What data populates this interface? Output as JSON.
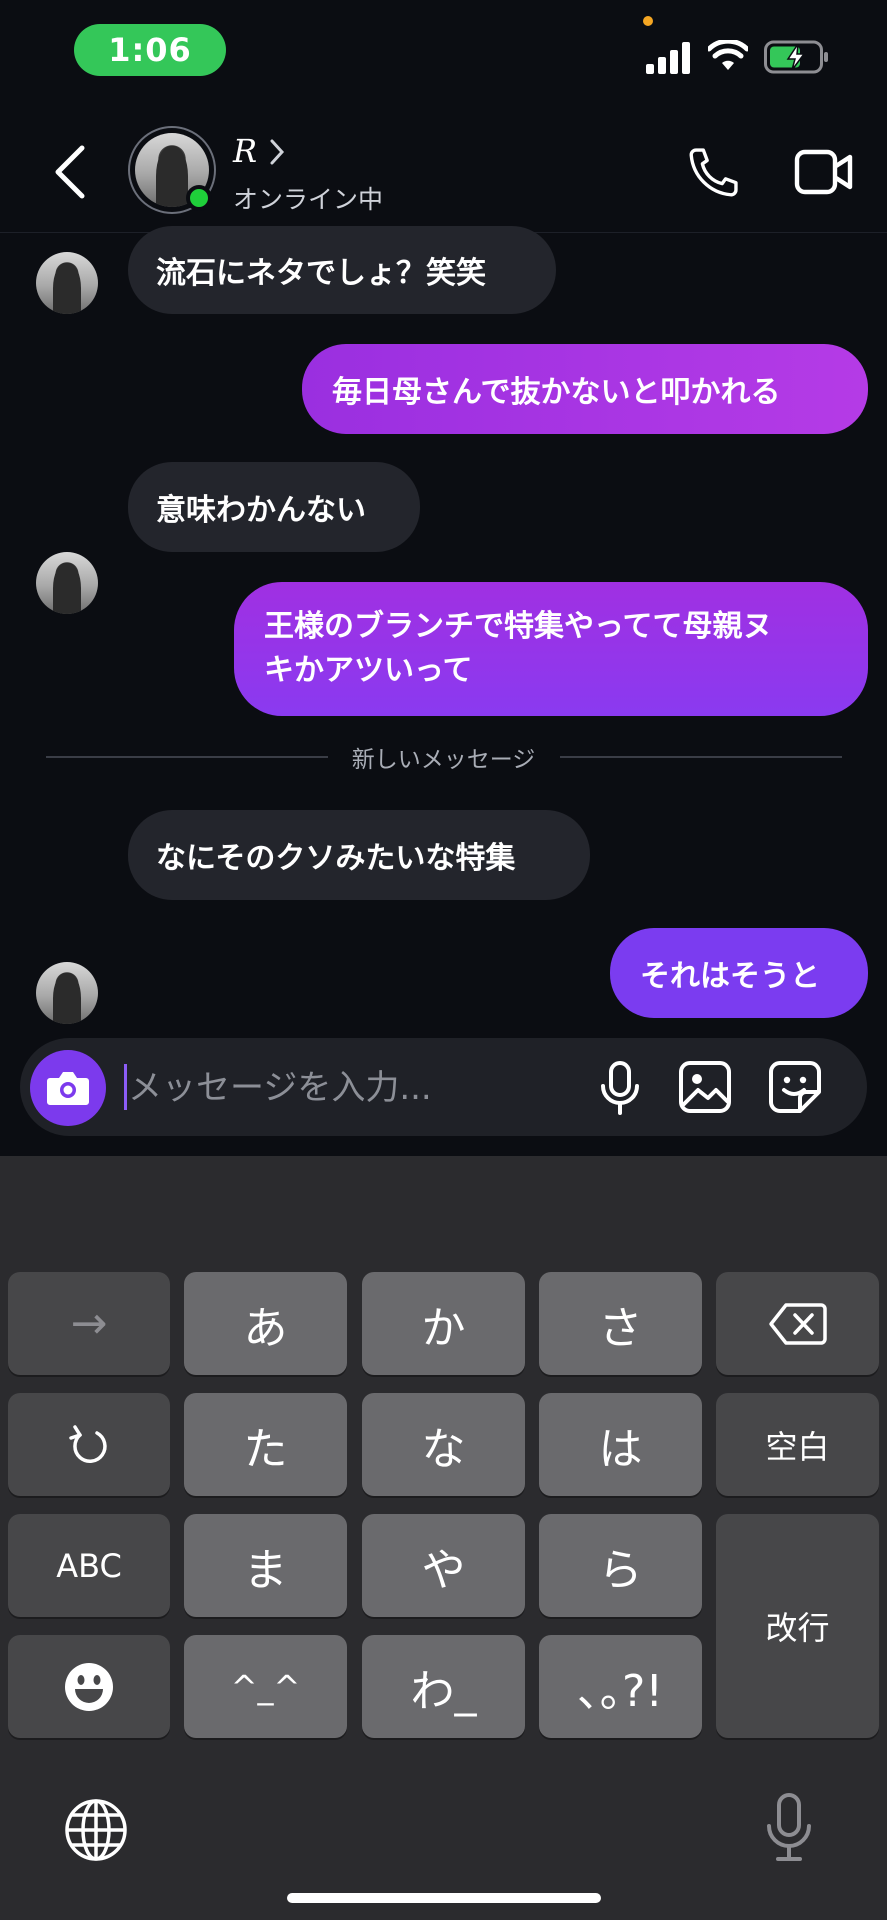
{
  "status_bar": {
    "time": "1:06"
  },
  "header": {
    "contact_name": "R",
    "status": "オンライン中"
  },
  "messages": [
    {
      "from": "them",
      "text": "流石にネタでしょ？笑笑"
    },
    {
      "from": "me",
      "text": "毎日母さんで抜かないと叩かれる"
    },
    {
      "from": "them",
      "text": "意味わかんない"
    },
    {
      "from": "me",
      "text_line1": "王様のブランチで特集やってて母親ヌ",
      "text_line2": "キかアツいって"
    },
    {
      "from": "them",
      "text": "なにそのクソみたいな特集"
    },
    {
      "from": "me",
      "text": "それはそうと"
    }
  ],
  "new_messages_divider": "新しいメッセージ",
  "composer": {
    "placeholder": "メッセージを入力..."
  },
  "keyboard": {
    "row1": [
      "→",
      "あ",
      "か",
      "さ"
    ],
    "row2": [
      "た",
      "な",
      "は",
      "空白"
    ],
    "row3": [
      "ABC",
      "ま",
      "や",
      "ら",
      "改行"
    ],
    "row4": [
      "^_^",
      "わ_",
      "､｡?!"
    ]
  },
  "colors": {
    "background": "#0b0d12",
    "bubble_incoming": "#23252c",
    "bubble_outgoing_top": "#a232e0",
    "bubble_outgoing_bottom": "#7b3cf0",
    "accent": "#7c3aed",
    "online": "#1fcf3a"
  }
}
